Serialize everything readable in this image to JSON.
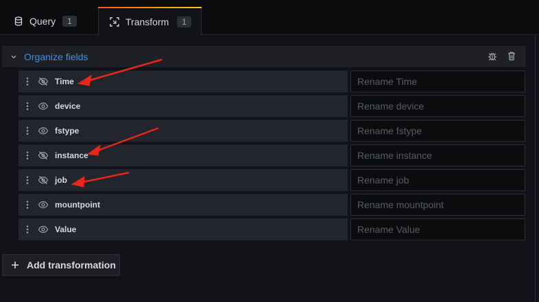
{
  "tabs": [
    {
      "label": "Query",
      "count": "1",
      "icon": "database-icon"
    },
    {
      "label": "Transform",
      "count": "1",
      "icon": "transform-icon",
      "active": true
    }
  ],
  "transformation": {
    "title": "Organize fields",
    "icons": [
      "bug-icon",
      "trash-icon"
    ]
  },
  "fields": [
    {
      "name": "Time",
      "visible": false,
      "placeholder": "Rename Time"
    },
    {
      "name": "device",
      "visible": true,
      "placeholder": "Rename device"
    },
    {
      "name": "fstype",
      "visible": true,
      "placeholder": "Rename fstype"
    },
    {
      "name": "instance",
      "visible": false,
      "placeholder": "Rename instance"
    },
    {
      "name": "job",
      "visible": false,
      "placeholder": "Rename job"
    },
    {
      "name": "mountpoint",
      "visible": true,
      "placeholder": "Rename mountpoint"
    },
    {
      "name": "Value",
      "visible": true,
      "placeholder": "Rename Value"
    }
  ],
  "add_button": {
    "label": "Add transformation"
  },
  "colors": {
    "accent_blue": "#3d8fe4",
    "arrow_red": "#e8261b",
    "tab_gradient_start": "#f05a28",
    "tab_gradient_end": "#fbca0a"
  }
}
